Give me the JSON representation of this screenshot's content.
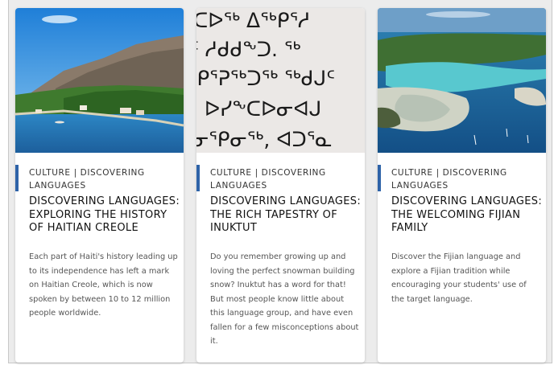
{
  "cards": [
    {
      "category": "CULTURE | DISCOVERING LANGUAGES",
      "title": "DISCOVERING LANGUAGES: EXPLORING THE HISTORY OF HAITIAN CREOLE",
      "description": "Each part of Haiti's history leading up to its independence has left a mark on Haitian Creole, which is now spoken by between 10 to 12 million people worldwide.",
      "image": "haiti-coast-photo"
    },
    {
      "category": "CULTURE | DISCOVERING LANGUAGES",
      "title": "DISCOVERING LANGUAGES: THE RICH TAPESTRY OF INUKTUT",
      "description": "Do you remember growing up and loving the perfect snowman building snow? Inuktut has a word for that! But most people know little about this language group, and have even fallen for a few misconceptions about it.",
      "image": "inuktut-syllabics-photo",
      "syllabics": [
        "ᑕᐅᖅ ᐃᖅᑭᕐᓱ",
        "ᑦ ᓱᑯᑯᖕᑐ. ᖅ",
        "ᕿᕐᕈᖅᑐᖅ ᖅᑯᒍᑦ",
        ". ᐅᓯᖕᑕᐅᓂᐊᒍ",
        "ᓂᕿᓂᖅ, ᐊᑐᕐᓇ"
      ]
    },
    {
      "category": "CULTURE | DISCOVERING LANGUAGES",
      "title": "DISCOVERING LANGUAGES: THE WELCOMING FIJIAN FAMILY",
      "description": "Discover the Fijian language and explore a Fijian tradition while encouraging your students' use of the target language.",
      "image": "fiji-lagoon-aerial-photo"
    }
  ],
  "colors": {
    "accent": "#2e63a8",
    "background": "#ececec",
    "card": "#ffffff"
  }
}
